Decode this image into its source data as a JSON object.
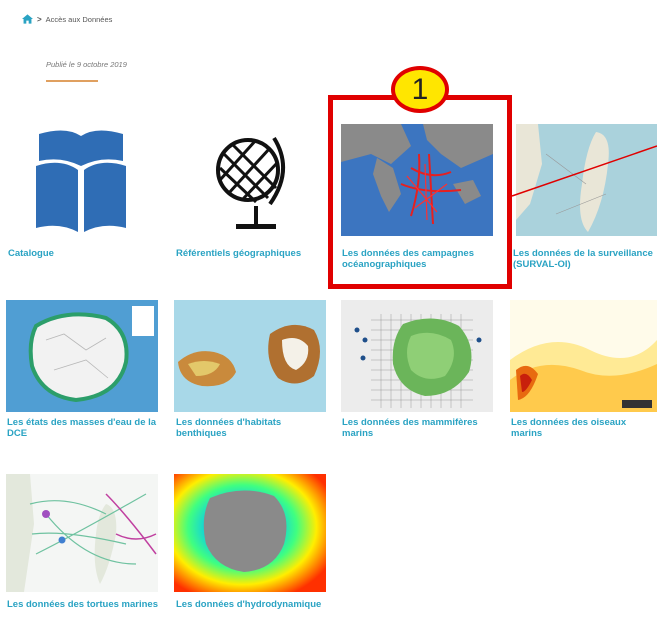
{
  "breadcrumb": {
    "home_icon": "home-icon",
    "separator": ">",
    "current": "Accès aux Données"
  },
  "published": "Publié le 9 octobre 2019",
  "tiles": [
    {
      "caption": "Catalogue",
      "thumb": "book-icon"
    },
    {
      "caption": "Référentiels géographiques",
      "thumb": "globe-icon"
    },
    {
      "caption": "Les données des campagnes océanographiques",
      "thumb": "ocean-map"
    },
    {
      "caption": "Les données de la surveillance (SURVAL-OI)",
      "thumb": "madagascar-map"
    },
    {
      "caption": "Les états des masses d'eau de la DCE",
      "thumb": "reunion-water-map"
    },
    {
      "caption": "Les données d'habitats benthiques",
      "thumb": "benthic-map"
    },
    {
      "caption": "Les données des mammifères marins",
      "thumb": "mammals-map"
    },
    {
      "caption": "Les données des oiseaux marins",
      "thumb": "birds-heatmap"
    },
    {
      "caption": "Les données des tortues marines",
      "thumb": "turtles-map"
    },
    {
      "caption": "Les données d'hydrodynamique",
      "thumb": "hydro-map"
    }
  ],
  "annotation": {
    "number": "1",
    "color": "#e00000",
    "fill": "#ffe600"
  },
  "colors": {
    "link": "#2aa3c3",
    "book": "#2f6db5"
  }
}
